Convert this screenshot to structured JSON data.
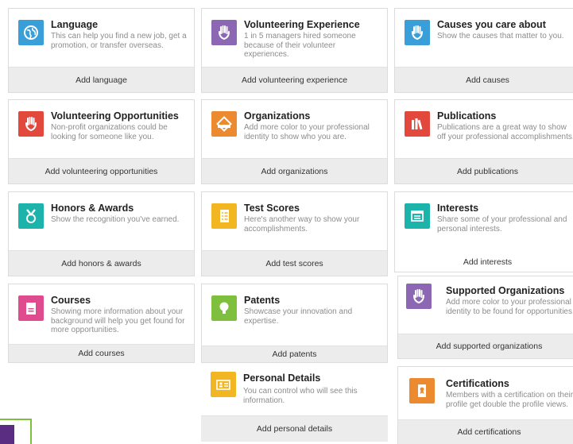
{
  "colors": {
    "blue": "#3a9fd8",
    "purple": "#8b67b4",
    "red": "#e2493c",
    "orange": "#eb8a2f",
    "teal": "#1bb3aa",
    "yellow": "#f3b623",
    "green": "#7fbf3e",
    "pink": "#e04a8e"
  },
  "cards": {
    "language": {
      "icon": "globe-icon",
      "title": "Language",
      "desc": "This can help you find a new job, get a promotion, or transfer overseas.",
      "action": "Add language"
    },
    "volunteering_experience": {
      "icon": "heart-hand-icon",
      "title": "Volunteering Experience",
      "desc": "1 in 5 managers hired someone because of their volunteer experiences.",
      "action": "Add volunteering experience"
    },
    "causes": {
      "icon": "heart-hand-icon",
      "title": "Causes you care about",
      "desc": "Show the causes that matter to you.",
      "action": "Add causes"
    },
    "volunteering_opportunities": {
      "icon": "heart-hand-icon",
      "title": "Volunteering Opportunities",
      "desc": "Non-profit organizations could be looking for someone like you.",
      "action": "Add volunteering opportunities"
    },
    "organizations": {
      "icon": "badge-icon",
      "title": "Organizations",
      "desc": "Add more color to your professional identity to show who you are.",
      "action": "Add organizations"
    },
    "publications": {
      "icon": "books-icon",
      "title": "Publications",
      "desc": "Publications are a great way to show off your professional accomplishments.",
      "action": "Add publications"
    },
    "honors": {
      "icon": "medal-icon",
      "title": "Honors & Awards",
      "desc": "Show the recognition you've earned.",
      "action": "Add honors & awards"
    },
    "test_scores": {
      "icon": "checklist-icon",
      "title": "Test Scores",
      "desc": "Here's another way to show your accomplishments.",
      "action": "Add test scores"
    },
    "interests": {
      "icon": "window-icon",
      "title": "Interests",
      "desc": "Share some of your professional and personal interests.",
      "action": "Add interests"
    },
    "courses": {
      "icon": "document-icon",
      "title": "Courses",
      "desc": "Showing more information about your background will help you get found for more opportunities.",
      "action": "Add courses"
    },
    "patents": {
      "icon": "lightbulb-icon",
      "title": "Patents",
      "desc": "Showcase your innovation and expertise.",
      "action": "Add patents"
    },
    "supported_organizations": {
      "icon": "heart-hand-icon",
      "title": "Supported Organizations",
      "desc": "Add more color to your professional identity to be found for opportunities.",
      "action": "Add supported organizations"
    },
    "personal_details": {
      "icon": "id-card-icon",
      "title": "Personal Details",
      "desc": "You can control who will see this information.",
      "action": "Add personal details"
    },
    "certifications": {
      "icon": "certificate-icon",
      "title": "Certifications",
      "desc": "Members with a certification on their profile get double the profile views.",
      "action": "Add certifications"
    }
  }
}
